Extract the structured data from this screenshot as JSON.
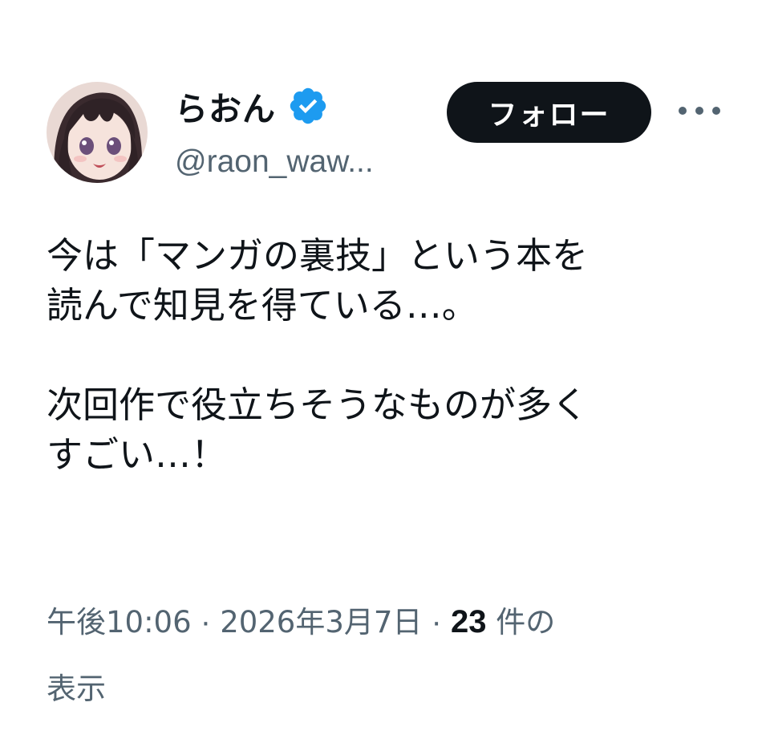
{
  "author": {
    "display_name": "らおん",
    "handle": "@raon_waw...",
    "verified": true,
    "verified_color": "#1d9bf0"
  },
  "actions": {
    "follow_label": "フォロー",
    "more_icon": "more-horizontal-icon"
  },
  "tweet": {
    "lines": [
      "今は「マンガの裏技」という本を",
      "読んで知見を得ている…。",
      "",
      "次回作で役立ちそうなものが多く",
      "すごい…！"
    ]
  },
  "meta": {
    "time": "午後10:06",
    "separator": " · ",
    "date": "2026年3月7日",
    "views_count": "23",
    "views_label_1": " 件の",
    "views_label_2": "表示"
  },
  "colors": {
    "text": "#0f1419",
    "secondary": "#536471",
    "follow_bg": "#0f1419"
  }
}
